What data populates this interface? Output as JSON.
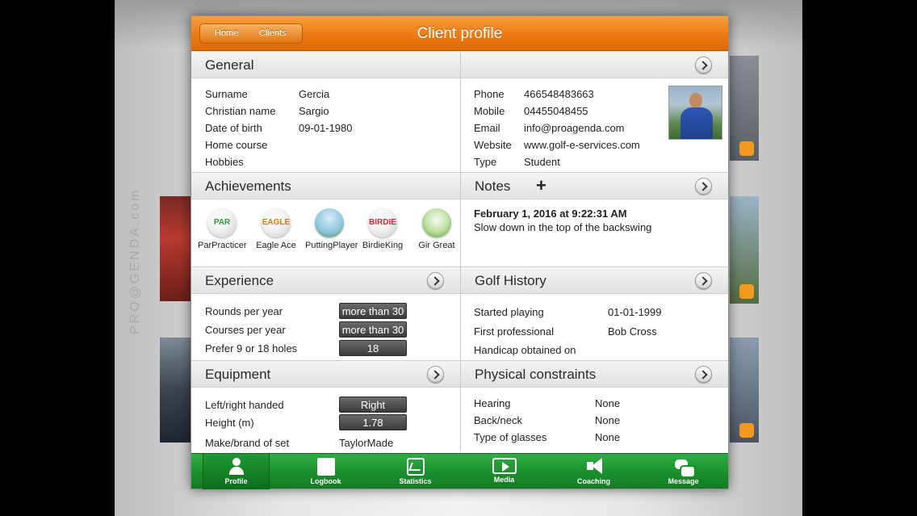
{
  "app": {
    "logo_text": "PRO@GENDA.com"
  },
  "header": {
    "title": "Client profile",
    "breadcrumbs": [
      "Home",
      "Clients"
    ]
  },
  "general": {
    "heading": "General",
    "fields": [
      {
        "label": "Surname",
        "value": "Gercia"
      },
      {
        "label": "Christian name",
        "value": "Sargio"
      },
      {
        "label": "Date of birth",
        "value": "09-01-1980"
      },
      {
        "label": "Home course",
        "value": ""
      },
      {
        "label": "Hobbies",
        "value": ""
      }
    ],
    "contact": [
      {
        "label": "Phone",
        "value": "466548483663"
      },
      {
        "label": "Mobile",
        "value": "04455048455"
      },
      {
        "label": "Email",
        "value": "info@proagenda.com"
      },
      {
        "label": "Website",
        "value": "www.golf-e-services.com"
      },
      {
        "label": "Type",
        "value": "Student"
      }
    ]
  },
  "achievements": {
    "heading": "Achievements",
    "items": [
      {
        "badge": "PAR",
        "label_1": "Par",
        "label_2": "Practicer"
      },
      {
        "badge": "EAGLE",
        "label_1": "Eagle Ace",
        "label_2": ""
      },
      {
        "badge": "",
        "label_1": "Putting",
        "label_2": "Player"
      },
      {
        "badge": "BIRDIE",
        "label_1": "Birdie",
        "label_2": "King"
      },
      {
        "badge": "",
        "label_1": "Gir Great",
        "label_2": ""
      }
    ]
  },
  "notes": {
    "heading": "Notes",
    "add_icon": "plus-icon",
    "entries": [
      {
        "date": "February 1, 2016 at 9:22:31 AM",
        "text": "Slow down in the top of the backswing"
      }
    ]
  },
  "experience": {
    "heading": "Experience",
    "fields": [
      {
        "label": "Rounds per year",
        "value": "more than 30"
      },
      {
        "label": "Courses per year",
        "value": "more than 30"
      },
      {
        "label": "Prefer 9 or 18 holes",
        "value": "18"
      }
    ]
  },
  "golf_history": {
    "heading": "Golf History",
    "fields": [
      {
        "label": "Started playing",
        "value": "01-01-1999"
      },
      {
        "label": "First professional",
        "value": "Bob Cross"
      },
      {
        "label": "Handicap obtained on",
        "value": ""
      }
    ]
  },
  "equipment": {
    "heading": "Equipment",
    "fields": [
      {
        "label": "Left/right handed",
        "value": "Right"
      },
      {
        "label": "Height (m)",
        "value": "1.78"
      },
      {
        "label": "Make/brand of set",
        "value": "TaylorMade"
      }
    ]
  },
  "physical": {
    "heading": "Physical constraints",
    "fields": [
      {
        "label": "Hearing",
        "value": "None"
      },
      {
        "label": "Back/neck",
        "value": "None"
      },
      {
        "label": "Type of glasses",
        "value": "None"
      }
    ]
  },
  "tabbar": {
    "active": "Profile",
    "tabs": [
      {
        "label": "Profile",
        "icon": "person-icon"
      },
      {
        "label": "Logbook",
        "icon": "book-icon"
      },
      {
        "label": "Statistics",
        "icon": "chart-icon"
      },
      {
        "label": "Media",
        "icon": "play-icon"
      },
      {
        "label": "Coaching",
        "icon": "megaphone-icon"
      },
      {
        "label": "Message",
        "icon": "chat-icon"
      }
    ]
  },
  "colors": {
    "header_orange": "#ee7a12",
    "tabbar_green": "#1b8f2d",
    "value_pill": "#4a4a4a"
  }
}
